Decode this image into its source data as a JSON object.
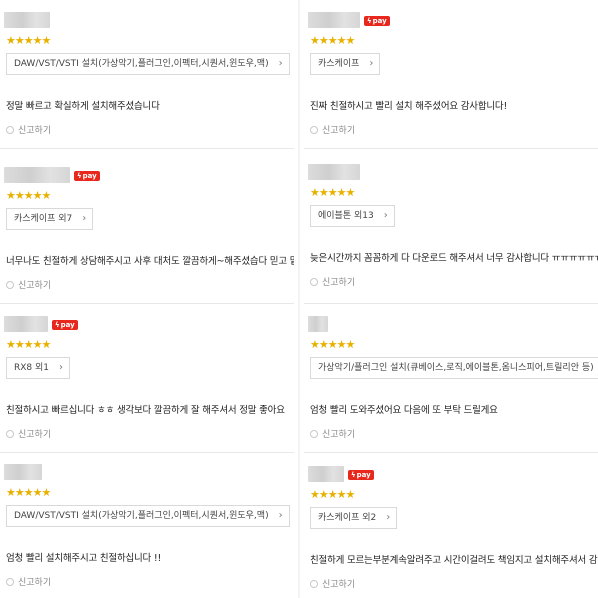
{
  "rating_stars": "★★★★★",
  "pay_label": "pay",
  "report_label": "신고하기",
  "colors": {
    "star": "#e8b100",
    "pay_badge": "#e8271d"
  },
  "left_reviews": [
    {
      "pay": false,
      "tag": "DAW/VST/VSTI 설치(가상악기,플러그인,이펙터,시퀀서,윈도우,맥)",
      "text": "정말 빠르고 확실하게 설치해주셨습니다"
    },
    {
      "pay": true,
      "tag": "카스케이프 외7",
      "text": "너무나도 친절하게 상담해주시고 사후 대처도 깔끔하게~해주셨습다 믿고 맡"
    },
    {
      "pay": true,
      "tag": "RX8 외1",
      "text": "친절하시고 빠르십니다 ㅎㅎ 생각보다 깔끔하게 잘 해주셔서 정말 좋아요"
    },
    {
      "pay": false,
      "tag": "DAW/VST/VSTI 설치(가상악기,플러그인,이펙터,시퀀서,윈도우,맥)",
      "text": "엄청 빨리 설치해주시고 친절하십니다 !!"
    }
  ],
  "right_reviews": [
    {
      "pay": true,
      "tag": "카스케이프",
      "text": "진짜 친절하시고 빨리 설치 해주셨어요 감사합니다!"
    },
    {
      "pay": false,
      "tag": "에이블톤 외13",
      "text": "늦은시간까지 꼼꼼하게 다 다운로드 해주셔서 너무 감사합니다 ㅠㅠㅠㅠㅠㅠㅠ"
    },
    {
      "pay": false,
      "tag": "가상악기/플러그인 설치(큐베이스,로직,에이블톤,옴니스피어,트릴리안 등)",
      "text": "엄청 빨리 도와주셨어요 다음에 또 부탁 드릴게요"
    },
    {
      "pay": true,
      "tag": "카스케이프 외2",
      "text": "친절하게 모르는부분계속알려주고 시간이걸려도 책임지고 설치해주셔서 감"
    }
  ]
}
